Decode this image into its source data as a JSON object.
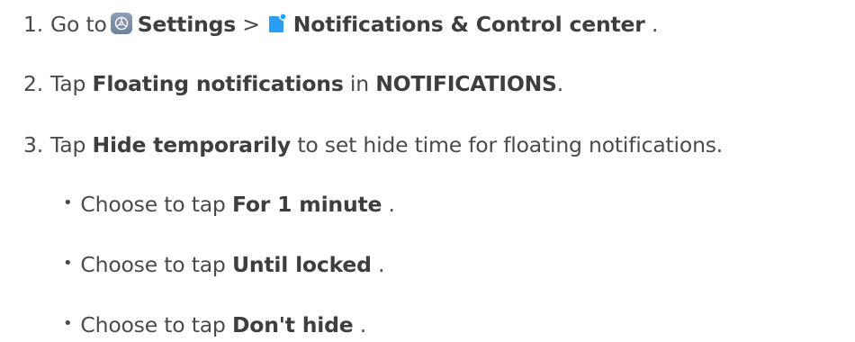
{
  "steps": [
    {
      "number": "1.",
      "go_to": "Go to",
      "settings_label": "Settings",
      "separator": ">",
      "notifications_label": "Notifications & Control center",
      "period": "."
    },
    {
      "number": "2.",
      "tap": "Tap",
      "floating_label": "Floating notifications",
      "in_text": "in",
      "section_label": "NOTIFICATIONS",
      "period": "."
    },
    {
      "number": "3.",
      "tap": "Tap",
      "hide_label": "Hide temporarily",
      "rest_text": "to set hide time for floating notifications."
    }
  ],
  "options": [
    {
      "bullet": "•",
      "prefix": "Choose to tap",
      "label": "For 1 minute",
      "period": "."
    },
    {
      "bullet": "•",
      "prefix": "Choose to tap",
      "label": "Until locked",
      "period": "."
    },
    {
      "bullet": "•",
      "prefix": "Choose to tap",
      "label": "Don't hide",
      "period": "."
    }
  ],
  "icons": {
    "settings": "settings-gear-icon",
    "notifications": "notification-badge-icon"
  },
  "colors": {
    "text": "#4a4a4a",
    "settings_icon": "#7d8ea6",
    "notification_icon": "#2a9df4"
  }
}
